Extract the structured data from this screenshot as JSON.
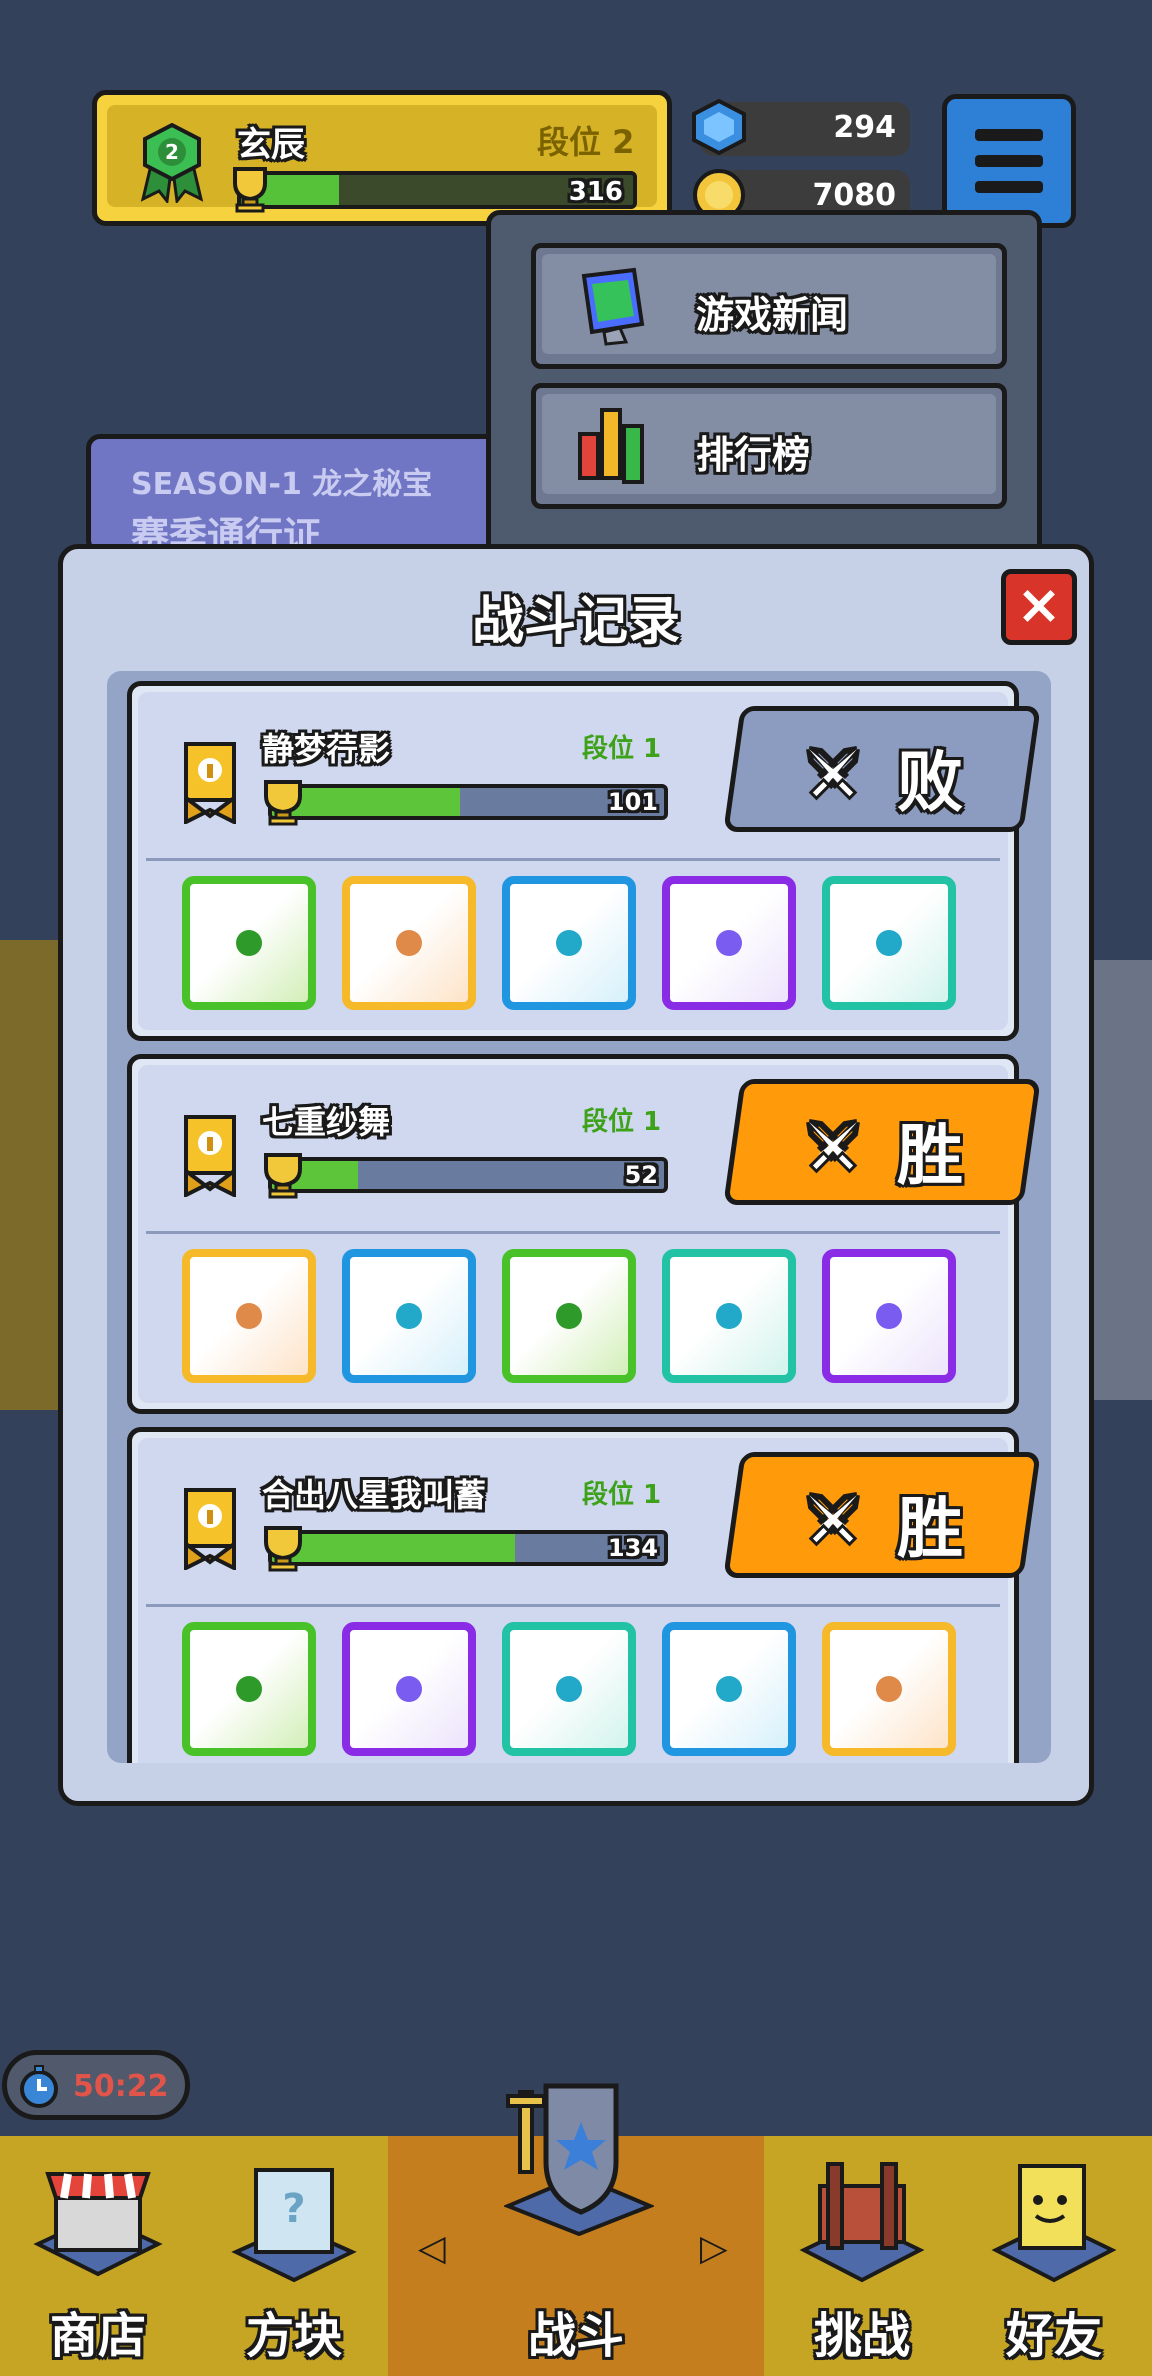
{
  "player": {
    "name": "玄辰",
    "rank_label": "段位 2",
    "rank_badge": "2",
    "trophy_value": "316",
    "trophy_progress": 0.25
  },
  "resources": {
    "gems": "294",
    "coins": "7080"
  },
  "menu": {
    "items": [
      {
        "label": "游戏新闻",
        "icon": "monitor-icon"
      },
      {
        "label": "排行榜",
        "icon": "bar-chart-icon"
      }
    ]
  },
  "season": {
    "line1": "SEASON-1 龙之秘宝",
    "line2": "赛季通行证"
  },
  "battle_log": {
    "title": "战斗记录",
    "close_label": "×",
    "records": [
      {
        "name": "静梦荇影",
        "rank": "段位 1",
        "trophies": "101",
        "progress": 0.48,
        "result": "败",
        "dice": [
          "green",
          "yellow",
          "blue",
          "purple",
          "teal"
        ]
      },
      {
        "name": "七重纱舞",
        "rank": "段位 1",
        "trophies": "52",
        "progress": 0.22,
        "result": "胜",
        "dice": [
          "yellow",
          "blue",
          "green",
          "teal",
          "purple"
        ]
      },
      {
        "name": "合出八星我叫蓄",
        "rank": "段位 1",
        "trophies": "134",
        "progress": 0.62,
        "result": "胜",
        "dice": [
          "green",
          "purple",
          "teal",
          "blue",
          "yellow"
        ]
      }
    ]
  },
  "timer": "50:22",
  "nav": {
    "shop": "商店",
    "dice": "方块",
    "battle": "战斗",
    "challenge": "挑战",
    "friends": "好友",
    "arrow_left": "◁",
    "arrow_right": "▷"
  },
  "colors": {
    "green": "#49c22a",
    "yellow": "#f5b92a",
    "blue": "#2196e0",
    "purple": "#8a2be6",
    "teal": "#22c2a4",
    "win": "#ff9a0a",
    "lose": "#8c9cc0"
  }
}
